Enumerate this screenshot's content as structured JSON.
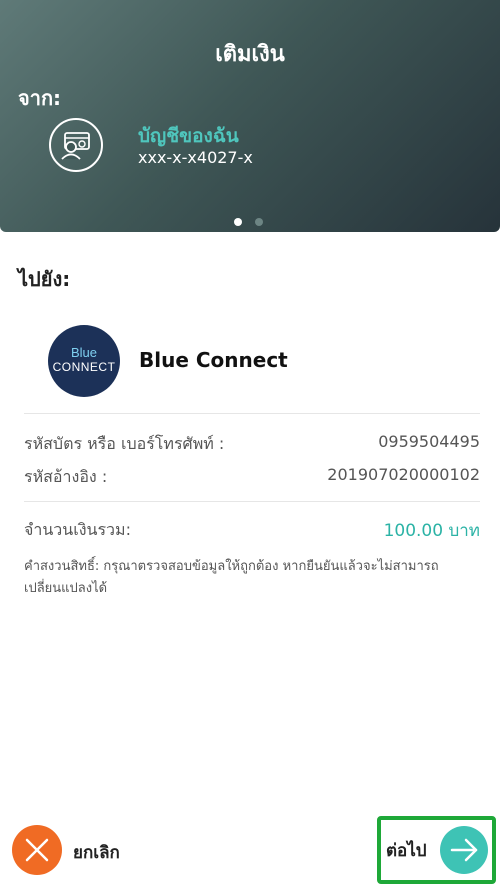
{
  "header": {
    "title": "เติมเงิน",
    "from_label": "จาก:",
    "account": {
      "name": "บัญชีของฉัน",
      "number": "xxx-x-x4027-x",
      "icon": "account-card-user-icon"
    },
    "pager": {
      "total": 2,
      "active": 1
    }
  },
  "destination": {
    "to_label": "ไปยัง:",
    "biller": {
      "logo_line1": "Blue",
      "logo_line2": "CONNECT",
      "name": "Blue Connect"
    }
  },
  "details": {
    "card_or_phone_label": "รหัสบัตร หรือ เบอร์โทรศัพท์ :",
    "card_or_phone_value": "0959504495",
    "reference_label": "รหัสอ้างอิง :",
    "reference_value": "201907020000102",
    "amount_label": "จำนวนเงินรวม:",
    "amount_value": "100.00 บาท",
    "disclaimer": "คำสงวนสิทธิ์: กรุณาตรวจสอบข้อมูลให้ถูกต้อง หากยืนยันแล้วจะไม่สามารถเปลี่ยนแปลงได้"
  },
  "actions": {
    "cancel_label": "ยกเลิก",
    "next_label": "ต่อไป"
  },
  "colors": {
    "accent_teal": "#3ec3b5",
    "cancel_orange": "#f06b24",
    "highlight_green": "#1ea838",
    "header_dark": "#26333a"
  }
}
